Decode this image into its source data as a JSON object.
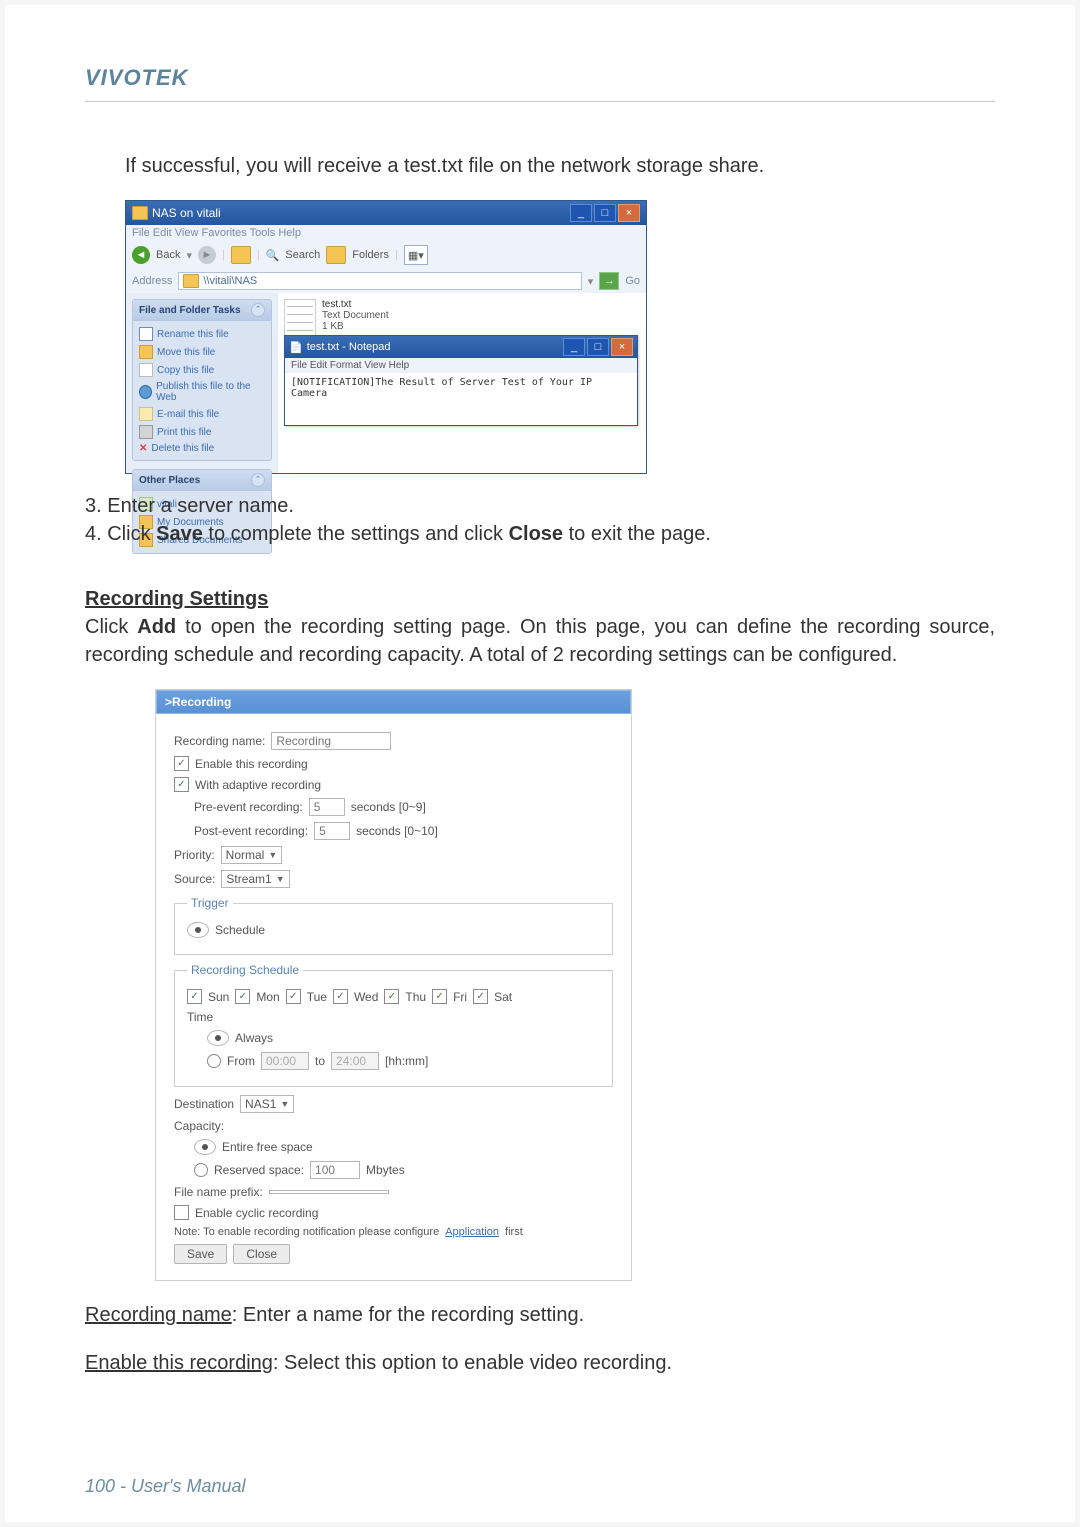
{
  "header": "VIVOTEK",
  "intro": "If successful, you will receive a test.txt file on the network storage share.",
  "explorer": {
    "title": "NAS on vitali",
    "menu": "File   Edit   View   Favorites   Tools   Help",
    "toolbar": {
      "back": "Back",
      "search": "Search",
      "folders": "Folders"
    },
    "address_label": "Address",
    "address_value": "\\\\vitali\\NAS",
    "go": "Go",
    "side_tasks_hd": "File and Folder Tasks",
    "tasks": {
      "rename": "Rename this file",
      "move": "Move this file",
      "copy": "Copy this file",
      "publish": "Publish this file to the Web",
      "email": "E-mail this file",
      "print": "Print this file",
      "delete": "Delete this file"
    },
    "side_places_hd": "Other Places",
    "places": {
      "vitali": "vitali",
      "mydocs": "My Documents",
      "shared": "Shared Documents"
    },
    "file": {
      "name": "test.txt",
      "type": "Text Document",
      "size": "1 KB"
    },
    "notepad": {
      "title": "test.txt - Notepad",
      "menu": "File  Edit  Format  View  Help",
      "content": "[NOTIFICATION]The Result of Server Test of Your IP Camera"
    }
  },
  "step3": "3. Enter a server name.",
  "step4_pre": "4. Click ",
  "step4_b1": "Save",
  "step4_mid": " to complete the settings and click ",
  "step4_b2": "Close",
  "step4_post": " to exit the page.",
  "rec_heading": "Recording Settings",
  "rec_para_pre": "Click ",
  "rec_para_b": "Add",
  "rec_para_post": " to open the recording setting page. On this page, you can define the recording source, recording schedule and recording capacity. A total of 2 recording settings can be configured.",
  "rec": {
    "header": ">Recording",
    "name_label": "Recording name:",
    "name_value": "Recording",
    "enable": "Enable this recording",
    "adaptive": "With adaptive recording",
    "pre_label": "Pre-event recording:",
    "pre_value": "5",
    "pre_unit": "seconds [0~9]",
    "post_label": "Post-event recording:",
    "post_value": "5",
    "post_unit": "seconds [0~10]",
    "priority_label": "Priority:",
    "priority_value": "Normal",
    "source_label": "Source:",
    "source_value": "Stream1",
    "trigger_legend": "Trigger",
    "trigger_schedule": "Schedule",
    "sched_legend": "Recording Schedule",
    "days": {
      "sun": "Sun",
      "mon": "Mon",
      "tue": "Tue",
      "wed": "Wed",
      "thu": "Thu",
      "fri": "Fri",
      "sat": "Sat"
    },
    "time_label": "Time",
    "always": "Always",
    "from_label": "From",
    "from_value": "00:00",
    "to_label": "to",
    "to_value": "24:00",
    "hhmm": "[hh:mm]",
    "dest_label": "Destination",
    "dest_value": "NAS1",
    "capacity_label": "Capacity:",
    "entire": "Entire free space",
    "reserved_label": "Reserved space:",
    "reserved_value": "100",
    "mb": "Mbytes",
    "prefix_label": "File name prefix:",
    "cyclic": "Enable cyclic recording",
    "note_pre": "Note: To enable recording notification please configure ",
    "note_link": "Application",
    "note_post": " first",
    "save": "Save",
    "close": "Close"
  },
  "desc1_u": "Recording name",
  "desc1_t": ": Enter a name for the recording setting.",
  "desc2_u": "Enable this recording",
  "desc2_t": ": Select this option to enable video recording.",
  "footer": "100 - User's Manual"
}
